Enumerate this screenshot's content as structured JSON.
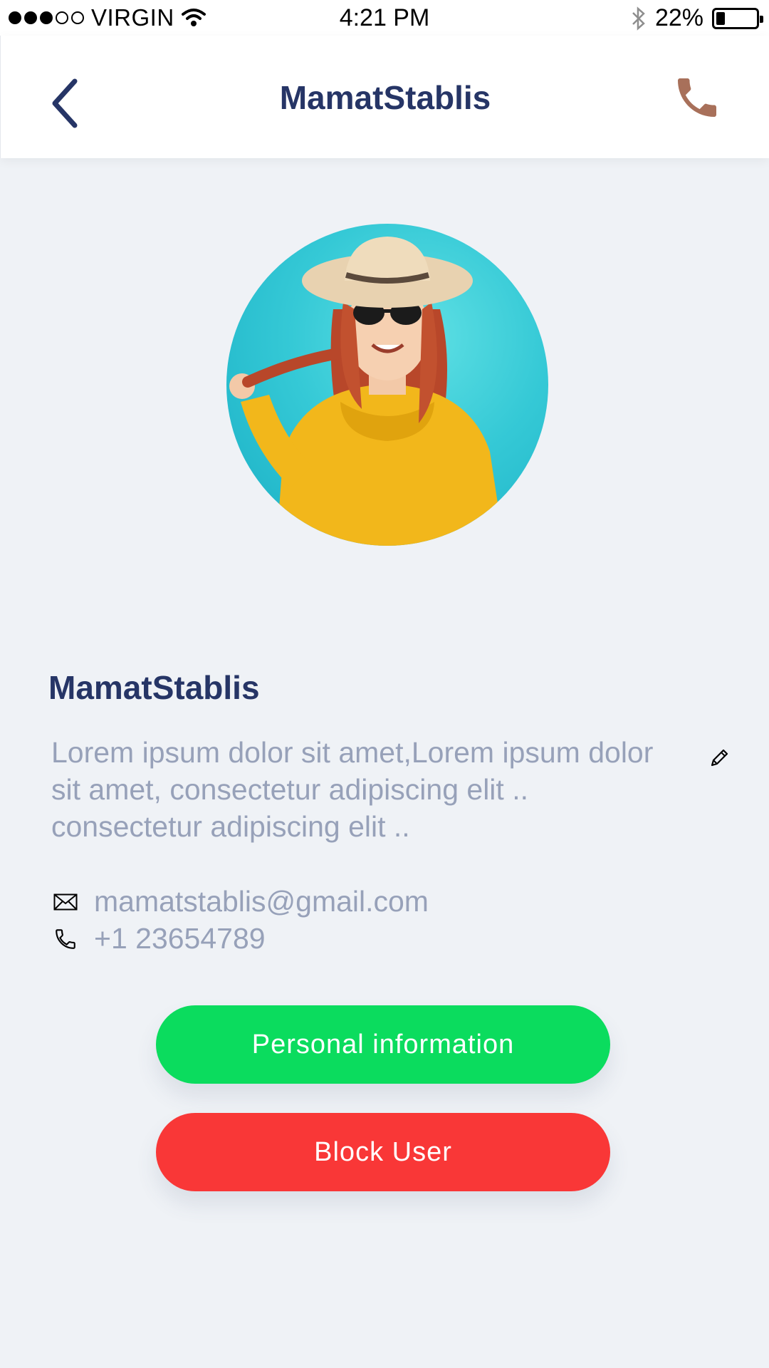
{
  "status_bar": {
    "carrier": "VIRGIN",
    "time": "4:21 PM",
    "battery": "22%",
    "battery_level": 0.22
  },
  "header": {
    "title": "MamatStablis",
    "back_icon": "chevron-left-icon",
    "call_icon": "phone-icon"
  },
  "profile": {
    "name": "MamatStablis",
    "bio": "Lorem ipsum dolor sit amet,Lorem ipsum dolor sit amet, consectetur adipiscing elit .. consectetur adipiscing elit ..",
    "email": "mamatstablis@gmail.com",
    "phone": "+1 23654789"
  },
  "actions": {
    "personal_info_label": "Personal information",
    "block_user_label": "Block User"
  },
  "colors": {
    "title": "#263566",
    "muted_text": "#97a1b9",
    "background": "#eff2f6",
    "call_icon": "#a8705a",
    "personal_button": "#0bdc5e",
    "block_button": "#f93737"
  }
}
